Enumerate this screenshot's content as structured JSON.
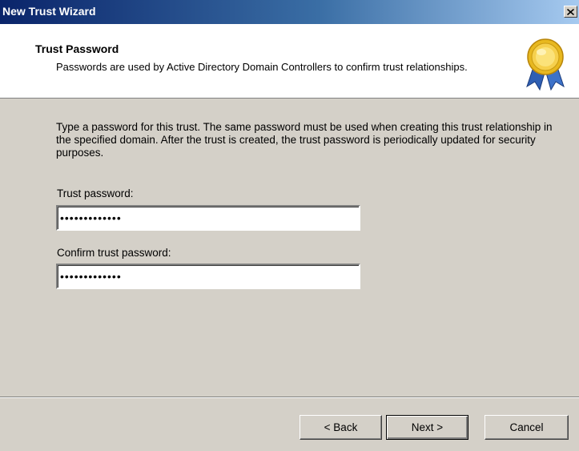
{
  "window": {
    "title": "New Trust Wizard"
  },
  "header": {
    "title": "Trust Password",
    "subtitle": "Passwords are used by Active Directory Domain Controllers to confirm trust relationships.",
    "icon": "award-ribbon-icon"
  },
  "body": {
    "intro": "Type a password for this trust. The same password must be used when creating this trust relationship in the specified domain. After the trust is created, the trust password is periodically updated for security purposes.",
    "trust_password_label": "Trust password:",
    "trust_password_value": "•••••••••••••",
    "confirm_password_label": "Confirm trust password:",
    "confirm_password_value": "•••••••••••••"
  },
  "buttons": {
    "back": "< Back",
    "next": "Next >",
    "cancel": "Cancel"
  },
  "colors": {
    "titlebar_start": "#0a246a",
    "titlebar_end": "#a6caf0",
    "dialog_bg": "#d4d0c8",
    "header_bg": "#ffffff"
  }
}
